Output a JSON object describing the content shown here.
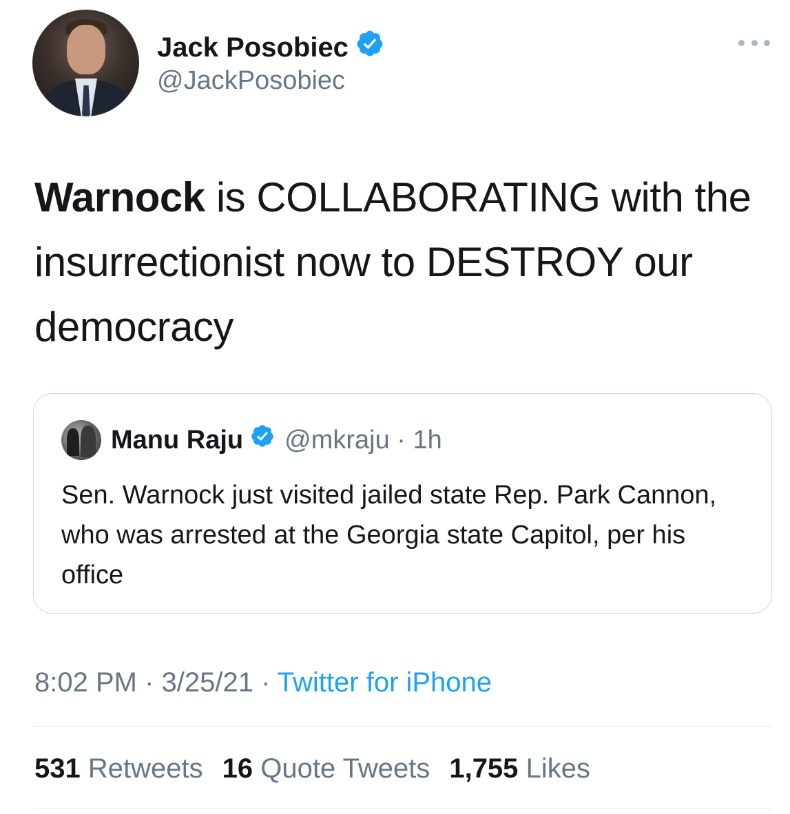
{
  "tweet": {
    "display_name": "Jack Posobiec",
    "handle": "@JackPosobiec",
    "text_bold": "Warnock",
    "text_rest": " is COLLABORATING with the insurrectionist now to DESTROY our democracy",
    "timestamp": "8:02 PM · 3/25/21 · ",
    "source": "Twitter for iPhone"
  },
  "quoted_tweet": {
    "display_name": "Manu Raju",
    "handle": "@mkraju",
    "separator": " · ",
    "time": "1h",
    "text": "Sen. Warnock just visited jailed state Rep. Park Cannon, who was arrested at the Georgia state Capitol, per his office"
  },
  "stats": [
    {
      "count": "531",
      "label": "Retweets"
    },
    {
      "count": "16",
      "label": "Quote Tweets"
    },
    {
      "count": "1,755",
      "label": "Likes"
    }
  ],
  "colors": {
    "verified": "#1da1f2",
    "link": "#1da1f2",
    "secondary_text": "#657786",
    "primary_text": "#14171a",
    "border": "#ccd6dd"
  },
  "icons": {
    "verified": "verified-badge-icon",
    "more": "more-options-icon"
  }
}
